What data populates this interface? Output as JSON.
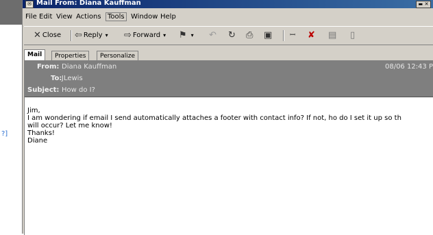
{
  "window": {
    "title": "Mail From: Diana Kauffman"
  },
  "menu": [
    "File",
    "Edit",
    "View",
    "Actions",
    "Tools",
    "Window",
    "Help"
  ],
  "toolbar": {
    "close": "Close",
    "reply": "Reply",
    "forward": "Forward"
  },
  "tabs": [
    "Mail",
    "Properties",
    "Personalize"
  ],
  "header": {
    "from_label": "From:",
    "from_value": "Diana Kauffman",
    "to_label": "To:",
    "to_value": "JLewis",
    "subject_label": "Subject:",
    "subject_value": "How do I?",
    "date": "08/06 12:43 P"
  },
  "body_lines": [
    "Jim,",
    "I am wondering if email I send automatically attaches a footer with contact info?  If not, ho do I set it up so th",
    "will occur?  Let me know!",
    "Thanks!",
    "Diane"
  ],
  "side_link": "?]"
}
